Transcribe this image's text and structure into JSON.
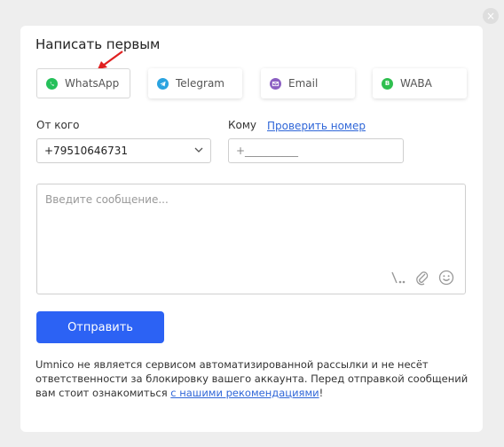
{
  "dialog": {
    "title": "Написать первым",
    "close_glyph": "×"
  },
  "channels": [
    {
      "label": "WhatsApp",
      "icon": "whatsapp-icon",
      "color": "#25c05a",
      "selected": true
    },
    {
      "label": "Telegram",
      "icon": "telegram-icon",
      "color": "#2aa3e0",
      "selected": false
    },
    {
      "label": "Email",
      "icon": "email-icon",
      "color": "#8b5fc2",
      "selected": false
    },
    {
      "label": "WABA",
      "icon": "waba-icon",
      "color": "#2fbf4f",
      "glyph": "B",
      "selected": false
    }
  ],
  "from": {
    "label": "От кого",
    "value": "+79510646731"
  },
  "to": {
    "label": "Кому",
    "check_link": "Проверить номер",
    "placeholder": "+__________"
  },
  "message": {
    "placeholder": "Введите сообщение..."
  },
  "send_button": "Отправить",
  "notice": {
    "text": "Umnico не является сервисом автоматизированной рассылки и не несёт ответственности за блокировку вашего аккаунта. Перед отправкой сообщений вам стоит ознакомиться ",
    "link": "с нашими рекомендациями",
    "suffix": "!"
  },
  "colors": {
    "primary": "#2c62f4",
    "link": "#2f66d8",
    "arrow": "#e02020"
  }
}
